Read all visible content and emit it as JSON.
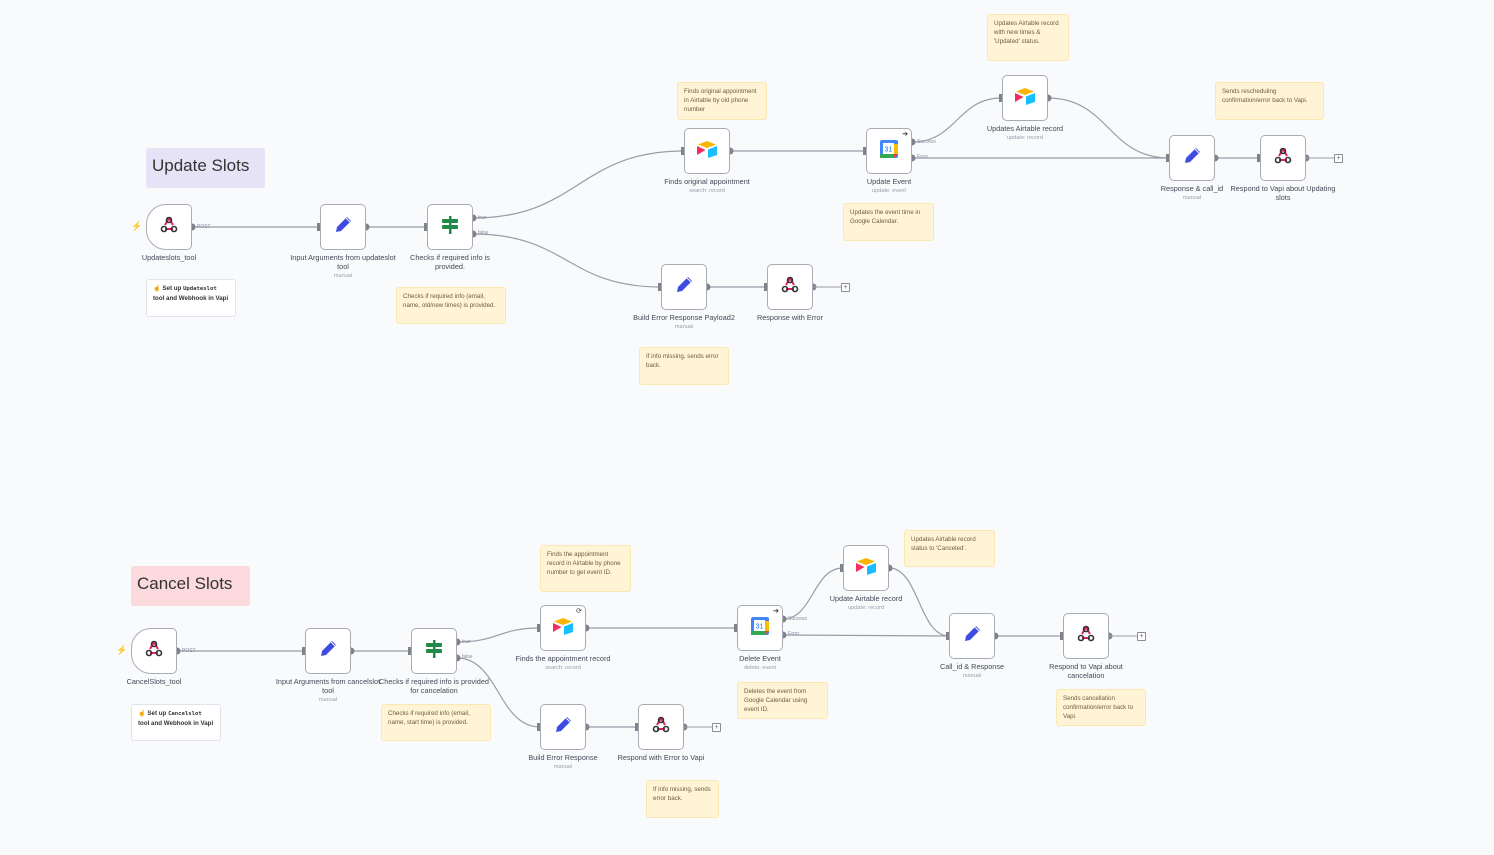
{
  "groups": {
    "update": {
      "title": "Update Slots",
      "color": "#e6e3f7"
    },
    "cancel": {
      "title": "Cancel Slots",
      "color": "#fbd9dc"
    }
  },
  "nodes": {
    "webhook1": {
      "label": "Updateslots_tool",
      "icon": "webhook-icon",
      "port": "POST"
    },
    "input1": {
      "label": "Input Arguments from updateslot tool",
      "sub": "manual",
      "icon": "pencil-icon"
    },
    "if1": {
      "label": "Checks if required info is provided.",
      "icon": "signpost-icon",
      "ports": [
        "true",
        "false"
      ]
    },
    "find1": {
      "label": "Finds original appointment",
      "sub": "search: record",
      "icon": "airtable-icon"
    },
    "updevent": {
      "label": "Update Event",
      "sub": "update: event",
      "icon": "google-calendar-icon",
      "ports": [
        "Success",
        "Error"
      ]
    },
    "updair": {
      "label": "Updates Airtable record",
      "sub": "update: record",
      "icon": "airtable-icon"
    },
    "resp1": {
      "label": "Response & call_id",
      "sub": "manual",
      "icon": "pencil-icon"
    },
    "vapi1": {
      "label": "Respond to Vapi about Updating slots",
      "icon": "webhook-icon"
    },
    "builderr1": {
      "label": "Build Error Response Payload2",
      "sub": "manual",
      "icon": "pencil-icon"
    },
    "resperr1": {
      "label": "Response with Error",
      "icon": "webhook-icon"
    },
    "webhook2": {
      "label": "CancelSlots_tool",
      "icon": "webhook-icon",
      "port": "POST"
    },
    "input2": {
      "label": "Input Arguments from cancelslot tool",
      "sub": "manual",
      "icon": "pencil-icon"
    },
    "if2": {
      "label": "Checks if required info is provided for cancelation",
      "icon": "signpost-icon",
      "ports": [
        "true",
        "false"
      ]
    },
    "find2": {
      "label": "Finds the appointment record",
      "sub": "search: record",
      "icon": "airtable-icon"
    },
    "delevent": {
      "label": "Delete Event",
      "sub": "delete: event",
      "icon": "google-calendar-icon",
      "ports": [
        "Success",
        "Error"
      ]
    },
    "updair2": {
      "label": "Update Airtable record",
      "sub": "update: record",
      "icon": "airtable-icon"
    },
    "callresp": {
      "label": "Call_id & Response",
      "sub": "manual",
      "icon": "pencil-icon"
    },
    "vapi2": {
      "label": "Respond to Vapi about cancelation",
      "icon": "webhook-icon"
    },
    "builderr2": {
      "label": "Build Error Response",
      "sub": "manual",
      "icon": "pencil-icon"
    },
    "resperr2": {
      "label": "Respond with Error to Vapi",
      "icon": "webhook-icon"
    }
  },
  "notes": {
    "setup1": {
      "prefix": "☝ Set up ",
      "code": "Updateslot",
      "suffix": " tool and Webhook in Vapi"
    },
    "check1": "Checks if required info (email, name, old/new times) is provided.",
    "find1": "Finds original appointment in Airtable by old phone number",
    "updair": "Updates Airtable record with new times & 'Updated' status.",
    "updevent": "Updates the event time in Google Calendar.",
    "resp1": "Sends rescheduling confirmation/error back to Vapi.",
    "err1": "If info missing, sends error back.",
    "setup2": {
      "prefix": "☝ Set up ",
      "code": "Cancelslot",
      "suffix": " tool and Webhook in Vapi"
    },
    "check2": "Checks if required info (email, name, start time) is provided.",
    "find2": "Finds the appointment record in Airtable by phone number to get event ID.",
    "updair2": "Updates Airtable record status to 'Canceled'.",
    "del": "Deletes the event from Google Calendar using event ID.",
    "cancelresp": "Sends cancellation confirmation/error back to Vapi.",
    "err2": "If info missing, sends error back."
  },
  "colors": {
    "edge": "#9a9ca6",
    "port": "#7f818c",
    "pencil": "#3e4de0",
    "signpost": "#1f8a47",
    "webhook": "#e0245e"
  }
}
